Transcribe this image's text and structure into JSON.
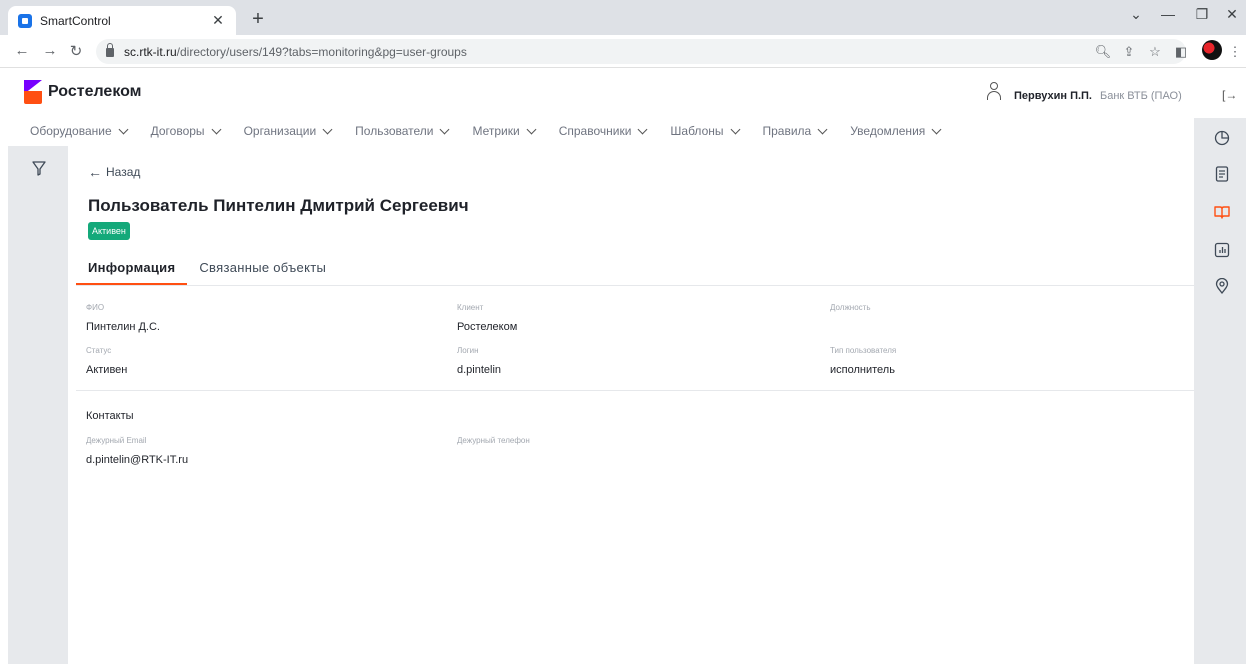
{
  "browser": {
    "tab_title": "SmartControl",
    "url_host": "sc.rtk-it.ru",
    "url_path": "/directory/users/149?tabs=monitoring&pg=user-groups"
  },
  "header": {
    "logo_text": "Ростелеком",
    "user_name": "Первухин П.П.",
    "user_org": "Банк ВТБ (ПАО)"
  },
  "nav": {
    "items": [
      {
        "label": "Оборудование"
      },
      {
        "label": "Договоры"
      },
      {
        "label": "Организации"
      },
      {
        "label": "Пользователи"
      },
      {
        "label": "Метрики"
      },
      {
        "label": "Справочники"
      },
      {
        "label": "Шаблоны"
      },
      {
        "label": "Правила"
      },
      {
        "label": "Уведомления"
      }
    ]
  },
  "page": {
    "back_label": "Назад",
    "title": "Пользователь Пинтелин Дмитрий Сергеевич",
    "status_badge": "Активен",
    "tabs": [
      {
        "label": "Информация",
        "active": true
      },
      {
        "label": "Связанные объекты",
        "active": false
      }
    ]
  },
  "info": {
    "fio_label": "ФИО",
    "fio_value": "Пинтелин Д.С.",
    "client_label": "Клиент",
    "client_value": "Ростелеком",
    "position_label": "Должность",
    "position_value": "",
    "status_label": "Статус",
    "status_value": "Активен",
    "login_label": "Логин",
    "login_value": "d.pintelin",
    "user_type_label": "Тип пользователя",
    "user_type_value": "исполнитель"
  },
  "contacts": {
    "section_title": "Контакты",
    "email_label": "Дежурный Email",
    "email_value": "d.pintelin@RTK-IT.ru",
    "phone_label": "Дежурный телефон",
    "phone_value": ""
  },
  "colors": {
    "brand_orange": "#ff4f12",
    "brand_purple": "#7700ff",
    "status_green": "#14a97a"
  }
}
